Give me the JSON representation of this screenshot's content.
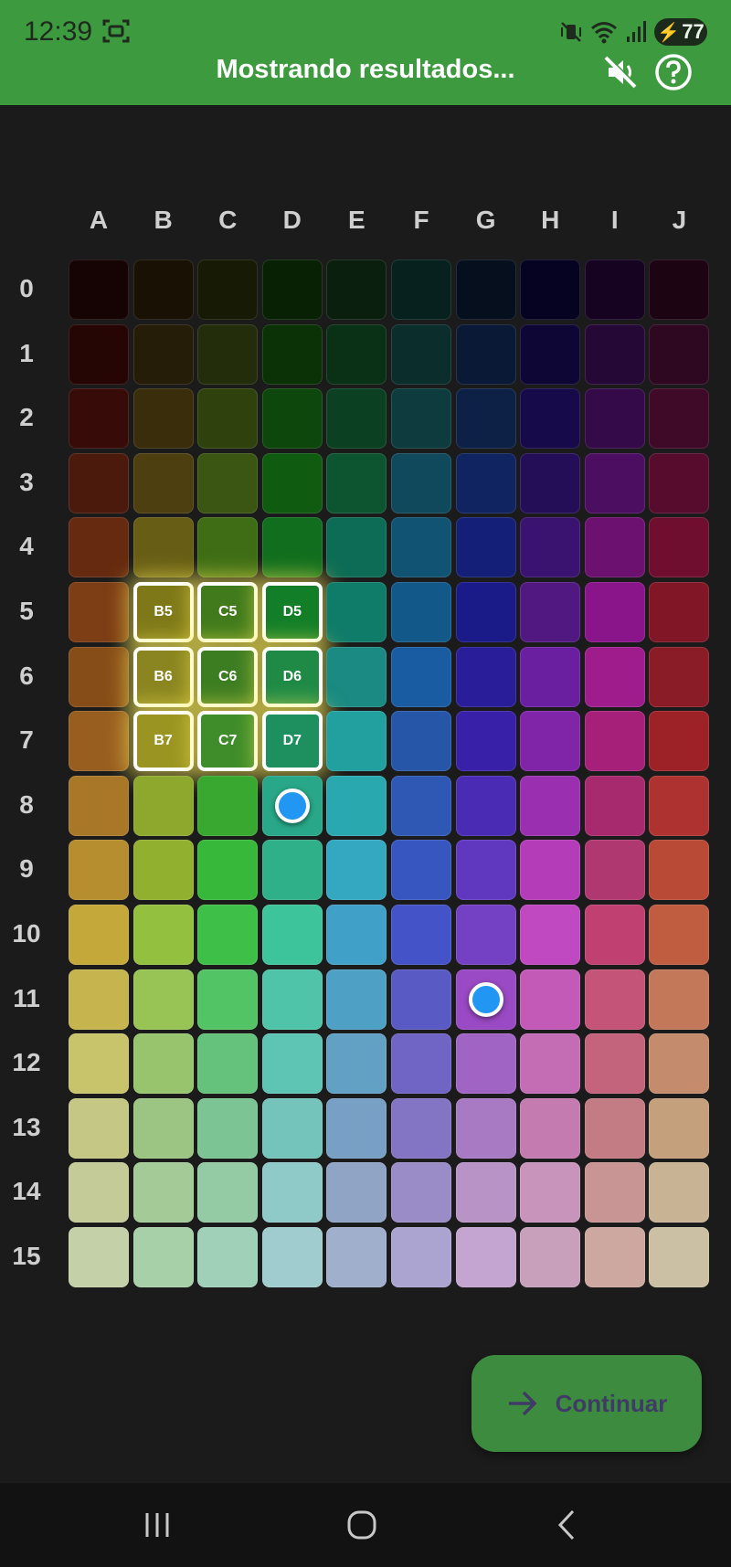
{
  "status": {
    "time": "12:39",
    "battery": "77",
    "icons": [
      "screenshot-icon",
      "vibrate-off-icon",
      "wifi-icon",
      "signal-icon",
      "battery-charging-icon"
    ]
  },
  "appbar": {
    "title": "Mostrando resultados...",
    "mute_icon": "volume-off-icon",
    "help_icon": "help-circle-icon"
  },
  "grid": {
    "columns": [
      "A",
      "B",
      "C",
      "D",
      "E",
      "F",
      "G",
      "H",
      "I",
      "J"
    ],
    "rows": [
      "0",
      "1",
      "2",
      "3",
      "4",
      "5",
      "6",
      "7",
      "8",
      "9",
      "10",
      "11",
      "12",
      "13",
      "14",
      "15"
    ],
    "colors": [
      [
        "#160303",
        "#181104",
        "#171a05",
        "#082104",
        "#0b1f0f",
        "#07211e",
        "#050f1e",
        "#050321",
        "#150321",
        "#1c0412"
      ],
      [
        "#260605",
        "#261d08",
        "#232d0b",
        "#0b3107",
        "#0a3016",
        "#0b2d2c",
        "#0a1a36",
        "#0e0736",
        "#250836",
        "#2e0820"
      ],
      [
        "#370c08",
        "#3a2d0b",
        "#2f420e",
        "#0d470b",
        "#0b4122",
        "#0e3c3e",
        "#0d2146",
        "#160a4a",
        "#340a48",
        "#3f0a28"
      ],
      [
        "#4c1a0d",
        "#4d3f10",
        "#3a5612",
        "#0f5b10",
        "#0d5530",
        "#10495c",
        "#0f2460",
        "#250e58",
        "#4c0e60",
        "#570c2e"
      ],
      [
        "#662a10",
        "#675d15",
        "#3e6d16",
        "#106e1e",
        "#0d6c55",
        "#115373",
        "#142078",
        "#3a1270",
        "#6d1170",
        "#6f0e2e"
      ],
      [
        "#7d3d15",
        "#7e7818",
        "#407a1c",
        "#127e28",
        "#0f7c6a",
        "#12598a",
        "#1a1a88",
        "#511882",
        "#8a148a",
        "#811626"
      ],
      [
        "#874d18",
        "#8a8520",
        "#3d7d22",
        "#1e8a46",
        "#1a8a82",
        "#1a5ca2",
        "#291d9a",
        "#6a1ea0",
        "#9e1c8c",
        "#8a1c28"
      ],
      [
        "#985e20",
        "#9a9422",
        "#3e8c2a",
        "#1e9060",
        "#22a0a0",
        "#2656a8",
        "#3820a8",
        "#8024a8",
        "#a6207a",
        "#9c2228"
      ],
      [
        "#a87828",
        "#8ea82e",
        "#38a830",
        "#28a888",
        "#2aa8b0",
        "#2e58b4",
        "#4a2cb4",
        "#9a30b0",
        "#a82a6e",
        "#ae3330"
      ],
      [
        "#b68e30",
        "#92b030",
        "#38b83a",
        "#30b088",
        "#34a8c0",
        "#3856c0",
        "#6038c0",
        "#b43cb8",
        "#b03870",
        "#b84a36"
      ],
      [
        "#c4a83a",
        "#94c040",
        "#3ec048",
        "#3ec49a",
        "#40a0c8",
        "#4454c8",
        "#7440c4",
        "#c048c0",
        "#c04072",
        "#c05c40"
      ],
      [
        "#c6b44e",
        "#98c456",
        "#52c466",
        "#50c4a8",
        "#4ea0c4",
        "#5a5ac4",
        "#9a4ac4",
        "#c45ab8",
        "#c45478",
        "#c4785a"
      ],
      [
        "#c8c46c",
        "#98c46e",
        "#64c27c",
        "#5ec4b4",
        "#62a0c4",
        "#7064c4",
        "#a064c4",
        "#c46cb4",
        "#c4647c",
        "#c48c6c"
      ],
      [
        "#c4c884",
        "#9cc482",
        "#7cc494",
        "#74c4bc",
        "#78a0c4",
        "#8474c4",
        "#a87ac4",
        "#c47cb0",
        "#c47c84",
        "#c4a07c"
      ],
      [
        "#c4ca98",
        "#a4ca98",
        "#94caa4",
        "#90cac8",
        "#90a4c6",
        "#9a8cc6",
        "#b894c6",
        "#c894bc",
        "#c89494",
        "#c8b494"
      ],
      [
        "#c4d0a8",
        "#a8d0a8",
        "#a0d0b8",
        "#a0ccd0",
        "#a0b0cc",
        "#aca4d0",
        "#c4a4d0",
        "#c8a0bc",
        "#cca8a0",
        "#ccc0a4"
      ]
    ],
    "selected": [
      {
        "col": "B",
        "row": "5",
        "label": "B5"
      },
      {
        "col": "C",
        "row": "5",
        "label": "C5"
      },
      {
        "col": "D",
        "row": "5",
        "label": "D5"
      },
      {
        "col": "B",
        "row": "6",
        "label": "B6"
      },
      {
        "col": "C",
        "row": "6",
        "label": "C6"
      },
      {
        "col": "D",
        "row": "6",
        "label": "D6"
      },
      {
        "col": "B",
        "row": "7",
        "label": "B7"
      },
      {
        "col": "C",
        "row": "7",
        "label": "C7"
      },
      {
        "col": "D",
        "row": "7",
        "label": "D7"
      }
    ],
    "markers": [
      {
        "col": "D",
        "row": "8"
      },
      {
        "col": "G",
        "row": "11"
      }
    ]
  },
  "fab": {
    "label": "Continuar",
    "icon": "arrow-right-icon"
  },
  "navbar": {
    "icons": [
      "recent-apps-icon",
      "home-icon",
      "back-icon"
    ]
  }
}
